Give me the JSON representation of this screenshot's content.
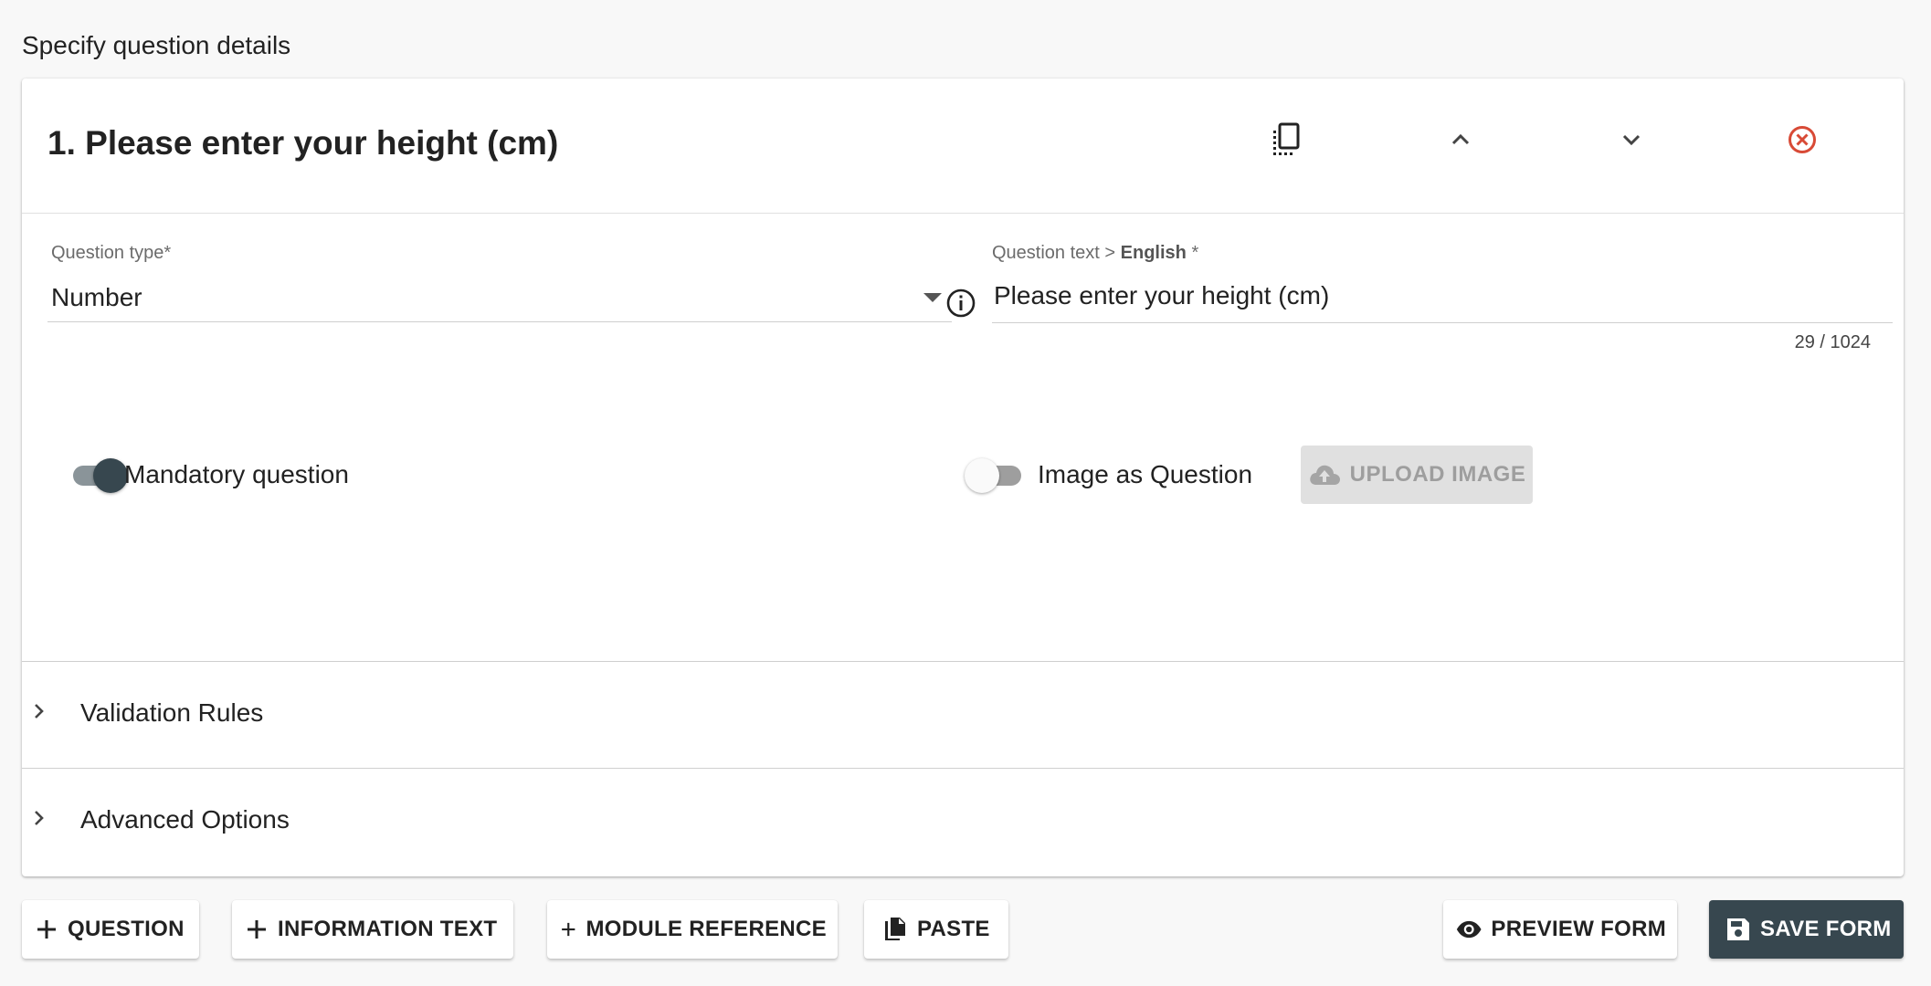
{
  "page": {
    "heading": "Specify question details"
  },
  "question": {
    "title": "1. Please enter your height (cm)",
    "header_icons": [
      "copy-icon",
      "chevron-up-icon",
      "chevron-down-icon",
      "close-circle-icon"
    ],
    "type": {
      "label": "Question type",
      "required_mark": "*",
      "value": "Number"
    },
    "text": {
      "label_prefix": "Question text >",
      "language": "English",
      "required_mark": "*",
      "value": "Please enter your height (cm)",
      "counter": "29 / 1024"
    },
    "mandatory": {
      "label": "Mandatory question",
      "on": true
    },
    "image_as_question": {
      "label": "Image as Question",
      "on": false
    },
    "upload_button": "UPLOAD IMAGE",
    "sections": [
      "Validation Rules",
      "Advanced Options"
    ]
  },
  "toolbar": {
    "add_question": "QUESTION",
    "add_information_text": "INFORMATION TEXT",
    "add_module_reference": "MODULE REFERENCE",
    "paste": "PASTE",
    "preview_form": "PREVIEW FORM",
    "save_form": "SAVE FORM"
  },
  "colors": {
    "accent_dark": "#37474f",
    "delete": "#d84a36",
    "switch_off_track": "#9e9e9e",
    "upload_disabled": "#e0e0e0"
  }
}
